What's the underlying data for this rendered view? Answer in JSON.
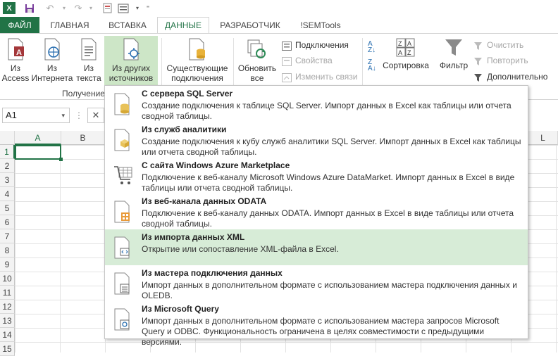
{
  "colors": {
    "accent": "#217346",
    "highlight": "#d7ecd7",
    "selected": "#cde6c7"
  },
  "tabs": [
    "ФАЙЛ",
    "ГЛАВНАЯ",
    "ВСТАВКА",
    "ДАННЫЕ",
    "РАЗРАБОТЧИК",
    "!SEMTools"
  ],
  "ribbon": {
    "from_access": [
      "Из",
      "Access"
    ],
    "from_web": [
      "Из",
      "Интернета"
    ],
    "from_text": [
      "Из",
      "текста"
    ],
    "from_other": [
      "Из других",
      "источников"
    ],
    "existing": [
      "Существующие",
      "подключения"
    ],
    "refresh": [
      "Обновить",
      "все"
    ],
    "connections": "Подключения",
    "properties": "Свойства",
    "edit_links": "Изменить связи",
    "sort": "Сортировка",
    "filter": "Фильтр",
    "clear": "Очистить",
    "reapply": "Повторить",
    "advanced": "Дополнительно",
    "group_get": "Получение"
  },
  "namebox": "A1",
  "columns": [
    "A",
    "B",
    "L"
  ],
  "rows": [
    "1",
    "2",
    "3",
    "4",
    "5",
    "6",
    "7",
    "8",
    "9",
    "10",
    "11",
    "12",
    "13",
    "14",
    "15"
  ],
  "menu": [
    {
      "title": "С сервера SQL Server",
      "desc": "Создание подключения к таблице SQL Server. Импорт данных в Excel как таблицы или отчета сводной таблицы."
    },
    {
      "title": "Из служб аналитики",
      "desc": "Создание подключения к кубу служб аналитики SQL Server. Импорт данных в Excel как таблицы или отчета сводной таблицы."
    },
    {
      "title": "С сайта Windows Azure Marketplace",
      "desc": "Подключение к веб-каналу Microsoft Windows Azure DataMarket. Импорт данных в Excel в виде таблицы или отчета сводной таблицы."
    },
    {
      "title": "Из веб-канала данных ODATA",
      "desc": "Подключение к веб-каналу данных ODATA. Импорт данных в Excel в виде таблицы или отчета сводной таблицы."
    },
    {
      "title": "Из импорта данных XML",
      "desc": "Открытие или сопоставление XML-файла в Excel."
    },
    {
      "title": "Из мастера подключения данных",
      "desc": "Импорт данных в дополнительном формате с использованием мастера подключения данных и OLEDB."
    },
    {
      "title": "Из Microsoft Query",
      "desc": "Импорт данных в дополнительном формате с использованием мастера запросов Microsoft Query и ODBC. Функциональность ограничена в целях совместимости с предыдущими версиями."
    }
  ]
}
